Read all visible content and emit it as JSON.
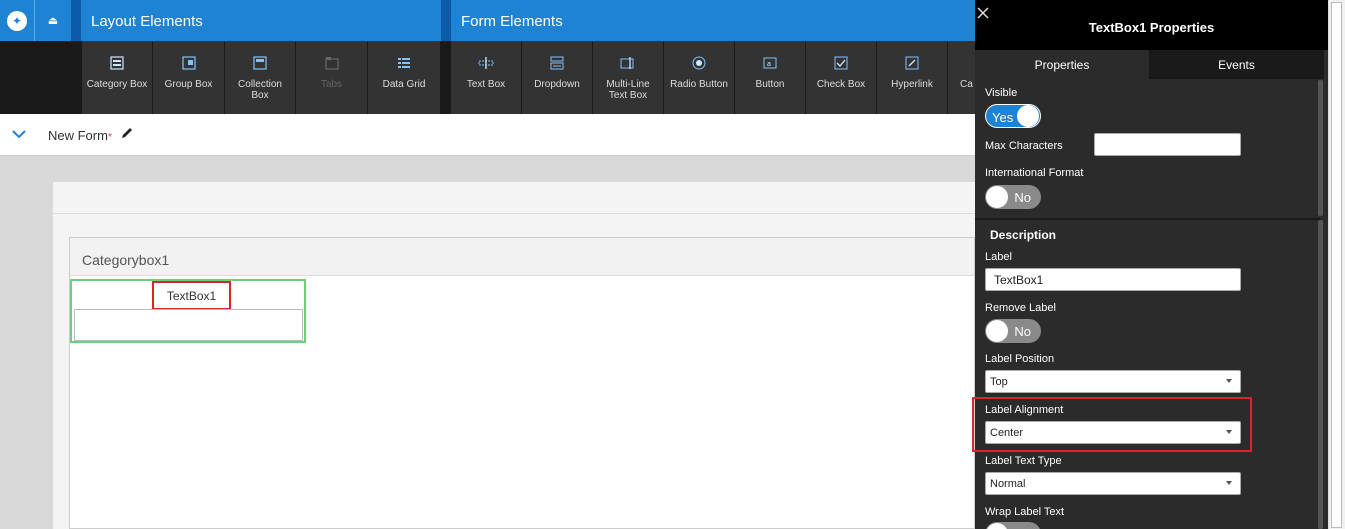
{
  "topbar": {
    "layout_title": "Layout Elements",
    "form_title": "Form Elements"
  },
  "layout_tools": [
    {
      "label": "Category Box",
      "icon": "category-box-icon",
      "disabled": false
    },
    {
      "label": "Group Box",
      "icon": "group-box-icon",
      "disabled": false
    },
    {
      "label": "Collection Box",
      "icon": "collection-box-icon",
      "disabled": false
    },
    {
      "label": "Tabs",
      "icon": "tabs-icon",
      "disabled": true
    },
    {
      "label": "Data Grid",
      "icon": "data-grid-icon",
      "disabled": false
    }
  ],
  "form_tools": [
    {
      "label": "Text Box",
      "icon": "text-box-icon"
    },
    {
      "label": "Dropdown",
      "icon": "dropdown-icon"
    },
    {
      "label": "Multi-Line Text Box",
      "icon": "multiline-text-box-icon"
    },
    {
      "label": "Radio Button",
      "icon": "radio-button-icon"
    },
    {
      "label": "Button",
      "icon": "button-icon"
    },
    {
      "label": "Check Box",
      "icon": "check-box-icon"
    },
    {
      "label": "Hyperlink",
      "icon": "hyperlink-icon"
    },
    {
      "label": "Ca",
      "icon": "calendar-icon"
    }
  ],
  "form": {
    "name": "New Form",
    "required_mark": "*"
  },
  "canvas": {
    "category_title": "Categorybox1",
    "textbox_label": "TextBox1"
  },
  "panel": {
    "title": "TextBox1 Properties",
    "tabs": [
      "Properties",
      "Events"
    ],
    "visible_label": "Visible",
    "visible_value": "Yes",
    "max_chars_label": "Max Characters",
    "max_chars_value": "",
    "intl_format_label": "International Format",
    "intl_format_value": "No",
    "description_title": "Description",
    "label_label": "Label",
    "label_value": "TextBox1",
    "remove_label_label": "Remove Label",
    "remove_label_value": "No",
    "label_position_label": "Label Position",
    "label_position_value": "Top",
    "label_alignment_label": "Label Alignment",
    "label_alignment_value": "Center",
    "label_text_type_label": "Label Text Type",
    "label_text_type_value": "Normal",
    "wrap_label_label": "Wrap Label Text"
  },
  "colors": {
    "accent": "#1f83d4",
    "highlight": "#d9262c",
    "selection": "#6cd17d"
  }
}
